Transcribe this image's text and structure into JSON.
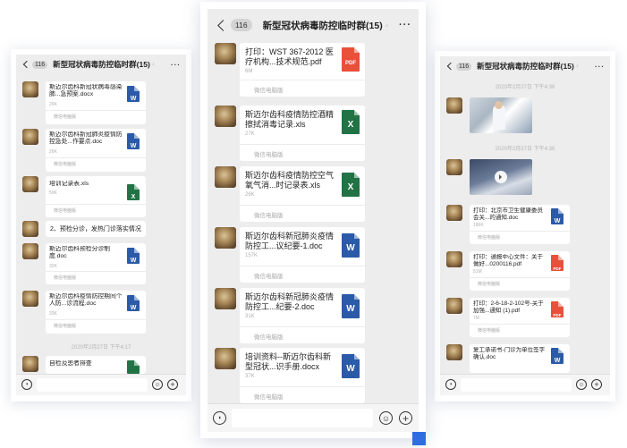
{
  "colors": {
    "word": "#2b5aa8",
    "excel": "#217346",
    "pdf": "#e8503a",
    "accent": "#2f6de0"
  },
  "left_phone": {
    "header": {
      "count": "116",
      "title": "新型冠状病毒防控临时群(15)",
      "more": "···"
    },
    "files": [
      {
        "name": "斯迈尔齿科新冠状病毒感染肺...急预案.docx",
        "size": "26K",
        "source": "微信电脑版",
        "icon": "word-icon"
      },
      {
        "name": "斯迈尔齿科新冠肺炎疫情防控急处...作要点.doc",
        "size": "26K",
        "source": "微信电脑版",
        "icon": "word-icon"
      },
      {
        "name": "培训记录表.xls",
        "size": "50K",
        "source": "微信电脑版",
        "icon": "excel-icon"
      }
    ],
    "text_message": "2、预检分诊，发热门诊落实情况",
    "files2": [
      {
        "name": "斯迈尔齿科预检分诊制度.doc",
        "size": "32K",
        "source": "微信电脑版",
        "icon": "word-icon"
      },
      {
        "name": "斯迈尔齿科疫情防控期间个人防...诊流程.doc",
        "size": "33K",
        "source": "微信电脑版",
        "icon": "word-icon"
      }
    ],
    "timestamp": "2020年2月27日 下午4:17",
    "last_file": {
      "name": "自检及患者排查",
      "icon": "excel-icon"
    }
  },
  "middle_phone": {
    "header": {
      "count": "116",
      "title": "新型冠状病毒防控临时群(15)",
      "more": "···"
    },
    "files": [
      {
        "name": "打印：WST 367-2012 医疗机构...技术规范.pdf",
        "size": "6M",
        "source": "微信电脑版",
        "icon": "pdf-icon",
        "icon_label": "PDF"
      },
      {
        "name": "斯迈尔齿科疫情防控酒精擦拭消毒记录.xls",
        "size": "27K",
        "source": "微信电脑版",
        "icon": "excel-icon",
        "icon_label": "X"
      },
      {
        "name": "斯迈尔齿科疫情防控空气氧气消...时记录表.xls",
        "size": "26K",
        "source": "微信电脑版",
        "icon": "excel-icon",
        "icon_label": "X"
      },
      {
        "name": "斯迈尔齿科新冠肺炎疫情防控工...议纪要-1.doc",
        "size": "157K",
        "source": "微信电脑版",
        "icon": "word-icon",
        "icon_label": "W"
      },
      {
        "name": "斯迈尔齿科新冠肺炎疫情防控工...纪要-2.doc",
        "size": "31K",
        "source": "微信电脑版",
        "icon": "word-icon",
        "icon_label": "W"
      },
      {
        "name": "培训资料--斯迈尔齿科新型冠状...识手册.docx",
        "size": "37K",
        "source": "微信电脑版",
        "icon": "word-icon",
        "icon_label": "W"
      }
    ]
  },
  "right_phone": {
    "header": {
      "count": "116",
      "title": "新型冠状病毒防控临时群(15)",
      "more": "···"
    },
    "timestamp1": "2020年2月27日 下午4:36",
    "timestamp2": "2020年2月27日 下午4:36",
    "files": [
      {
        "name": "打印：北京市卫生健康委员会关...的通知.doc",
        "size": "186K",
        "source": "微信电脑版",
        "icon": "word-icon"
      },
      {
        "name": "打印：通报中心文件：关于做好...0200116.pdf",
        "size": "51M",
        "source": "微信电脑版",
        "icon": "pdf-icon"
      },
      {
        "name": "打印：2-6-18-2-102号-关于加强...通知 (1).pdf",
        "size": "7M",
        "source": "微信电脑版",
        "icon": "pdf-icon"
      },
      {
        "name": "复工承诺书-门诊为单位签字确认.doc",
        "size": "",
        "source": "微信电脑版",
        "icon": "word-icon"
      }
    ]
  }
}
